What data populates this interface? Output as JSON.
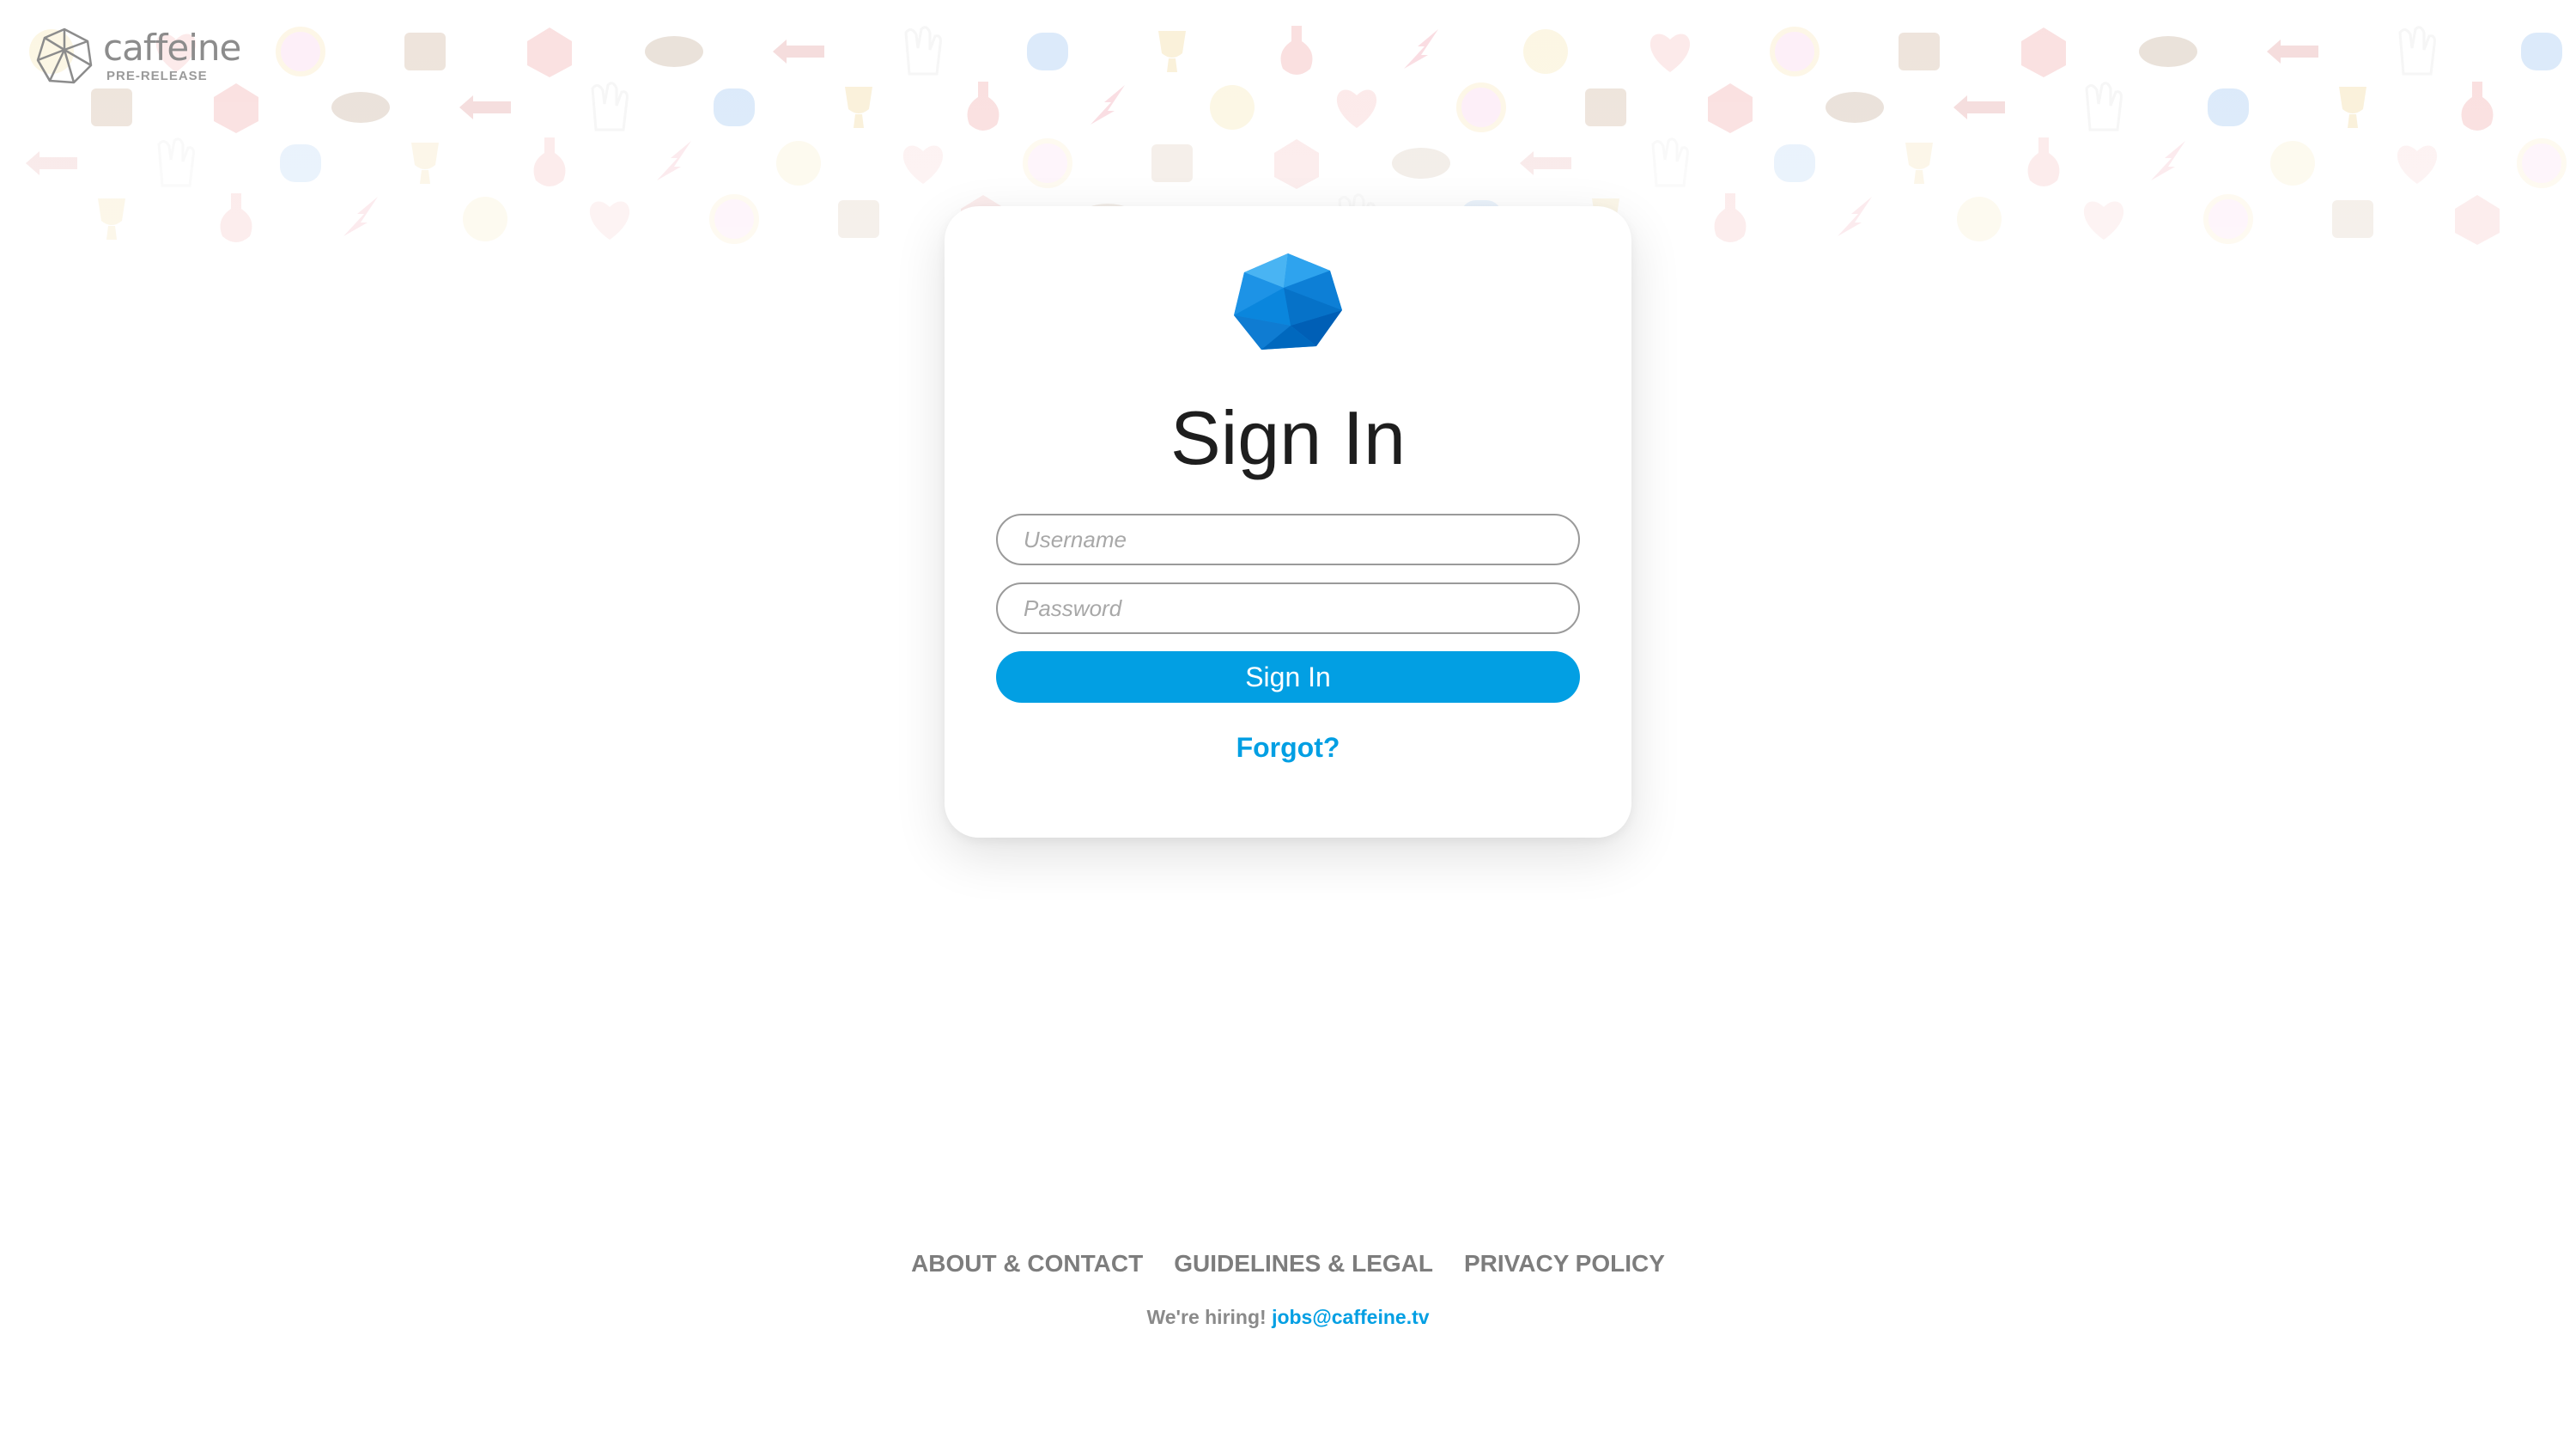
{
  "brand": {
    "name": "caffeine",
    "badge": "PRE-RELEASE",
    "icon": "caffeine-logo-icon"
  },
  "signin": {
    "icon": "caffeine-gem-icon",
    "title": "Sign In",
    "username_placeholder": "Username",
    "password_placeholder": "Password",
    "submit_label": "Sign In",
    "forgot_label": "Forgot?"
  },
  "footer": {
    "links": [
      "ABOUT & CONTACT",
      "GUIDELINES & LEGAL",
      "PRIVACY POLICY"
    ],
    "hiring_text": "We're hiring!",
    "hiring_email": "jobs@caffeine.tv"
  },
  "colors": {
    "accent": "#029fe3",
    "muted_text": "#7d7d7d",
    "card_bg": "#ffffff"
  }
}
